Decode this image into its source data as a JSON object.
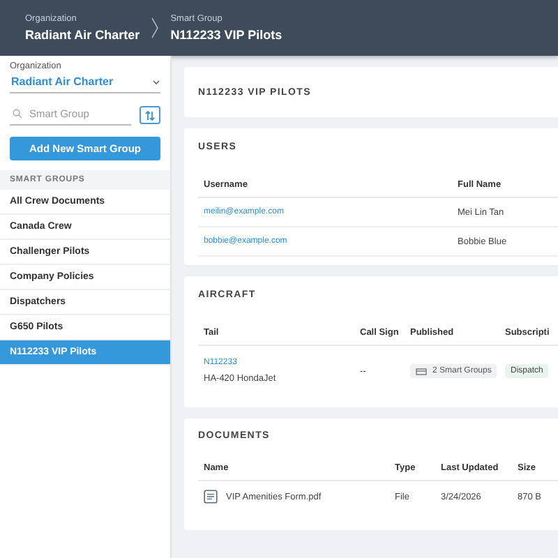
{
  "header": {
    "breadcrumbs": [
      {
        "label": "Organization",
        "value": "Radiant Air Charter"
      },
      {
        "label": "Smart Group",
        "value": "N112233 VIP Pilots"
      }
    ]
  },
  "sidebar": {
    "organization": {
      "label": "Organization",
      "value": "Radiant Air Charter"
    },
    "search": {
      "placeholder": "Smart Group"
    },
    "add_button": "Add New Smart Group",
    "section_title": "SMART GROUPS",
    "items": [
      {
        "label": "All Crew Documents",
        "selected": false
      },
      {
        "label": "Canada Crew",
        "selected": false
      },
      {
        "label": "Challenger Pilots",
        "selected": false
      },
      {
        "label": "Company Policies",
        "selected": false
      },
      {
        "label": "Dispatchers",
        "selected": false
      },
      {
        "label": "G650 Pilots",
        "selected": false
      },
      {
        "label": "N112233 VIP Pilots",
        "selected": true
      }
    ]
  },
  "title": "N112233 VIP PILOTS",
  "users": {
    "title": "USERS",
    "columns": [
      "Username",
      "Full Name"
    ],
    "rows": [
      {
        "username": "meilin@example.com",
        "full_name": "Mei Lin Tan"
      },
      {
        "username": "bobbie@example.com",
        "full_name": "Bobbie Blue"
      }
    ]
  },
  "aircraft": {
    "title": "AIRCRAFT",
    "columns": [
      "Tail",
      "Call Sign",
      "Published",
      "Subscripti"
    ],
    "rows": [
      {
        "tail": "N112233",
        "model": "HA-420 HondaJet",
        "call_sign": "--",
        "published": "2 Smart Groups",
        "subscription": "Dispatch"
      }
    ]
  },
  "documents": {
    "title": "DOCUMENTS",
    "columns": [
      "Name",
      "Type",
      "Last Updated",
      "Size"
    ],
    "rows": [
      {
        "name": "VIP Amenities Form.pdf",
        "type": "File",
        "last_updated": "3/24/2026",
        "size": "870 B"
      }
    ]
  }
}
